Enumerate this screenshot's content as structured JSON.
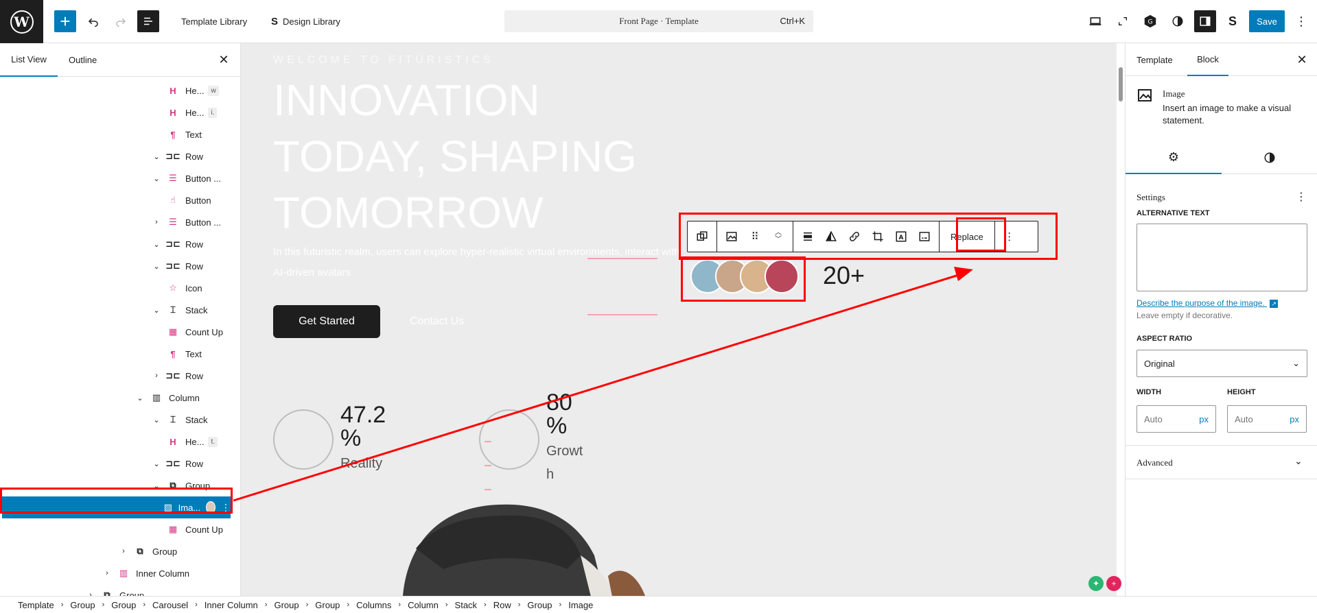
{
  "topbar": {
    "template_library": "Template Library",
    "design_library": "Design Library",
    "command_title": "Front Page · Template",
    "command_shortcut": "Ctrl+K",
    "save_label": "Save"
  },
  "left_panel": {
    "tabs": [
      "List View",
      "Outline"
    ],
    "tree": [
      {
        "label": "He...",
        "badge": "w",
        "icon": "heading-icon",
        "indent": 1,
        "chev": ""
      },
      {
        "label": "He...",
        "badge": "i.",
        "icon": "heading-icon",
        "indent": 1,
        "chev": ""
      },
      {
        "label": "Text",
        "badge": "",
        "icon": "paragraph-icon",
        "indent": 1,
        "chev": ""
      },
      {
        "label": "Row",
        "badge": "",
        "icon": "row-icon",
        "indent": 1,
        "chev": "down"
      },
      {
        "label": "Button ...",
        "badge": "",
        "icon": "buttons-icon",
        "indent": 1,
        "chev": "down"
      },
      {
        "label": "Button",
        "badge": "",
        "icon": "button-icon",
        "indent": 1,
        "chev": ""
      },
      {
        "label": "Button ...",
        "badge": "",
        "icon": "buttons-icon",
        "indent": 1,
        "chev": "right"
      },
      {
        "label": "Row",
        "badge": "",
        "icon": "row-icon",
        "indent": 1,
        "chev": "down"
      },
      {
        "label": "Row",
        "badge": "",
        "icon": "row-icon",
        "indent": 1,
        "chev": "down"
      },
      {
        "label": "Icon",
        "badge": "",
        "icon": "star-icon",
        "indent": 1,
        "chev": ""
      },
      {
        "label": "Stack",
        "badge": "",
        "icon": "stack-icon",
        "indent": 1,
        "chev": "down"
      },
      {
        "label": "Count Up",
        "badge": "",
        "icon": "count-up-icon",
        "indent": 1,
        "chev": ""
      },
      {
        "label": "Text",
        "badge": "",
        "icon": "paragraph-icon",
        "indent": 1,
        "chev": ""
      },
      {
        "label": "Row",
        "badge": "",
        "icon": "row-icon",
        "indent": 1,
        "chev": "right"
      },
      {
        "label": "Column",
        "badge": "",
        "icon": "column-icon",
        "indent": 0,
        "chev": "down"
      },
      {
        "label": "Stack",
        "badge": "",
        "icon": "stack-icon",
        "indent": 1,
        "chev": "down"
      },
      {
        "label": "He...",
        "badge": "t.",
        "icon": "heading-icon",
        "indent": 1,
        "chev": ""
      },
      {
        "label": "Row",
        "badge": "",
        "icon": "row-icon",
        "indent": 1,
        "chev": "down"
      },
      {
        "label": "Group",
        "badge": "",
        "icon": "group-icon",
        "indent": 1,
        "chev": "down"
      },
      {
        "label": "Ima...",
        "badge": "",
        "icon": "image-icon",
        "indent": 1,
        "chev": "",
        "selected": true
      },
      {
        "label": "Count Up",
        "badge": "",
        "icon": "count-up-icon",
        "indent": 1,
        "chev": ""
      },
      {
        "label": "Group",
        "badge": "",
        "icon": "group-icon",
        "indent": -1,
        "chev": "right"
      },
      {
        "label": "Inner Column",
        "badge": "",
        "icon": "inner-column-icon",
        "indent": -2,
        "chev": "right"
      },
      {
        "label": "Group",
        "badge": "",
        "icon": "group-icon",
        "indent": -3,
        "chev": "right"
      }
    ]
  },
  "canvas": {
    "welcome": "WELCOME TO FITURISTICS",
    "headline": "INNOVATION TODAY, SHAPING TOMORROW",
    "intro": "In this futuristic realm, users can explore hyper-realistic virtual environments, interact with AI-driven avatars",
    "get_started": "Get Started",
    "contact_us": "Contact Us",
    "stat1_value": "47.2 %",
    "stat1_label": "Reality",
    "stat2_value": "80 %",
    "stat2_label": "Growt h",
    "count_label": "20+",
    "toolbar_replace": "Replace"
  },
  "right_panel": {
    "tabs": [
      "Template",
      "Block"
    ],
    "block_title": "Image",
    "block_desc": "Insert an image to make a visual statement.",
    "settings_title": "Settings",
    "alt_label": "ALTERNATIVE TEXT",
    "alt_link": "Describe the purpose of the image.",
    "alt_help": "Leave empty if decorative.",
    "aspect_label": "ASPECT RATIO",
    "aspect_value": "Original",
    "width_label": "WIDTH",
    "height_label": "HEIGHT",
    "width_placeholder": "Auto",
    "height_placeholder": "Auto",
    "unit": "px",
    "advanced": "Advanced"
  },
  "breadcrumb": [
    "Template",
    "Group",
    "Group",
    "Carousel",
    "Inner Column",
    "Group",
    "Group",
    "Columns",
    "Column",
    "Stack",
    "Row",
    "Group",
    "Image"
  ],
  "colors": {
    "accent": "#007cba",
    "annotation": "#ff0000",
    "block_pink": "#d63384"
  }
}
